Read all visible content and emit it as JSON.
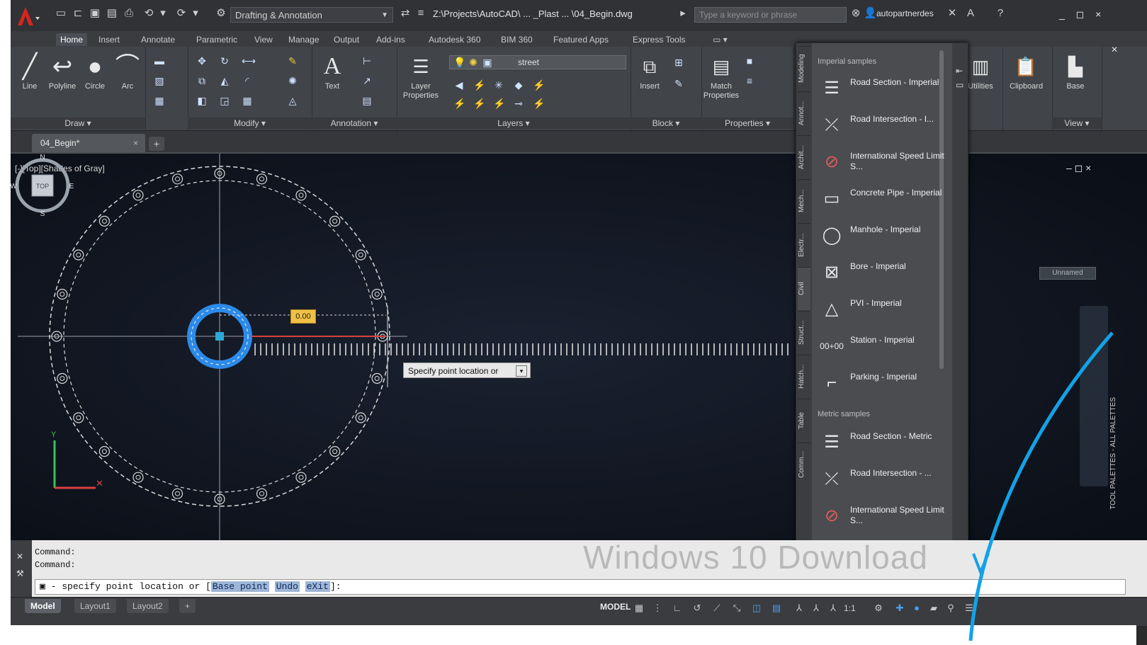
{
  "titlebar": {
    "workspace": "Drafting & Annotation",
    "document_title": "Z:\\Projects\\AutoCAD\\ ... _Plast ... \\04_Begin.dwg",
    "search_placeholder": "Type a keyword or phrase",
    "user": "autopartnerdes",
    "help": "?"
  },
  "ribbon_tabs": [
    "Home",
    "Insert",
    "Annotate",
    "Parametric",
    "View",
    "Manage",
    "Output",
    "Add-ins",
    "Autodesk 360",
    "BIM 360",
    "Featured Apps",
    "Express Tools"
  ],
  "ribbon": {
    "draw": {
      "title": "Draw",
      "tools": [
        "Line",
        "Polyline",
        "Circle",
        "Arc"
      ]
    },
    "modify": {
      "title": "Modify"
    },
    "annotation": {
      "title": "Annotation",
      "text_label": "Text"
    },
    "layers": {
      "title": "Layers",
      "layer_properties": "Layer Properties",
      "current_layer": "street"
    },
    "block": {
      "title": "Block",
      "insert_label": "Insert"
    },
    "properties": {
      "title": "Properties",
      "match_label": "Match Properties"
    },
    "utilities": {
      "label": "Utilities"
    },
    "clipboard": {
      "label": "Clipboard"
    },
    "view": {
      "base_label": "Base",
      "title": "View"
    }
  },
  "file_tabs": {
    "active": "04_Begin*",
    "close": "×",
    "new": "+"
  },
  "viewport": {
    "label": "[-][Top][Shades of Gray]",
    "dynamic_input": "0.00",
    "prompt": "Specify point location or",
    "viewcube": {
      "n": "N",
      "s": "S",
      "e": "E",
      "w": "W",
      "top": "TOP",
      "wcs": "Unnamed"
    },
    "window_controls": "– ◻ ×"
  },
  "palette": {
    "section_imperial": "Imperial samples",
    "section_metric": "Metric samples",
    "title": "TOOL PALETTES - ALL PALETTES",
    "tabs": [
      "Modeling",
      "Annot...",
      "Archit...",
      "Mech...",
      "Electr...",
      "Civil",
      "Struct...",
      "Hatch...",
      "Table",
      "Comm..."
    ],
    "items": [
      "Road Section - Imperial",
      "Road Intersection - I...",
      "International Speed Limit S...",
      "Concrete Pipe - Imperial",
      "Manhole - Imperial",
      "Bore - Imperial",
      "PVI - Imperial",
      "Station - Imperial",
      "Parking - Imperial",
      "Road Section - Metric",
      "Road Intersection - ...",
      "International Speed Limit S..."
    ]
  },
  "command": {
    "history": [
      "Command:",
      "Command:"
    ],
    "current_prefix": "- specify point location or",
    "kw1": "Base point",
    "kw2": "Undo",
    "kw3": "eXit",
    "current_suffix": "]:"
  },
  "layout_tabs": [
    "Model",
    "Layout1",
    "Layout2",
    "+"
  ],
  "status": {
    "model": "MODEL",
    "scale": "1:1"
  },
  "watermark": "Windows 10 Download"
}
